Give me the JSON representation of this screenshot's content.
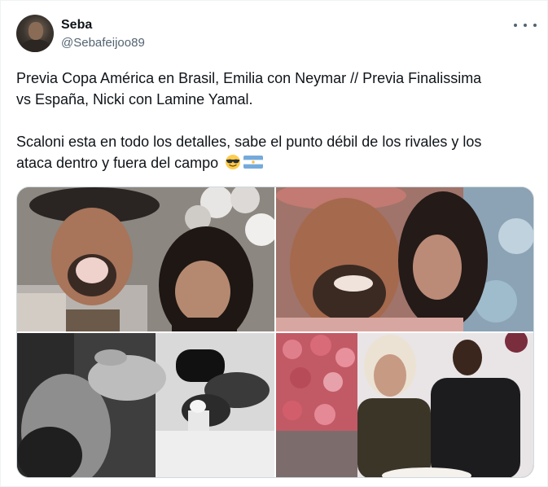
{
  "tweet": {
    "author": {
      "name": "Seba",
      "handle": "@Sebafeijoo89"
    },
    "text": {
      "line1": "Previa Copa América en Brasil, Emilia con Neymar // Previa Finalissima",
      "line2": "vs España, Nicki con Lamine Yamal.",
      "line3": "Scaloni esta en todo los detalles, sabe el punto débil de los rivales y los",
      "line4": "ataca dentro y fuera del campo"
    },
    "emojis": [
      "sunglasses-emoji",
      "argentina-flag-emoji"
    ],
    "media": {
      "photos": [
        "photo-1",
        "photo-2",
        "photo-3",
        "photo-4"
      ]
    }
  },
  "colors": {
    "text_primary": "#0f1419",
    "text_secondary": "#536471",
    "border": "#cfd9de"
  }
}
